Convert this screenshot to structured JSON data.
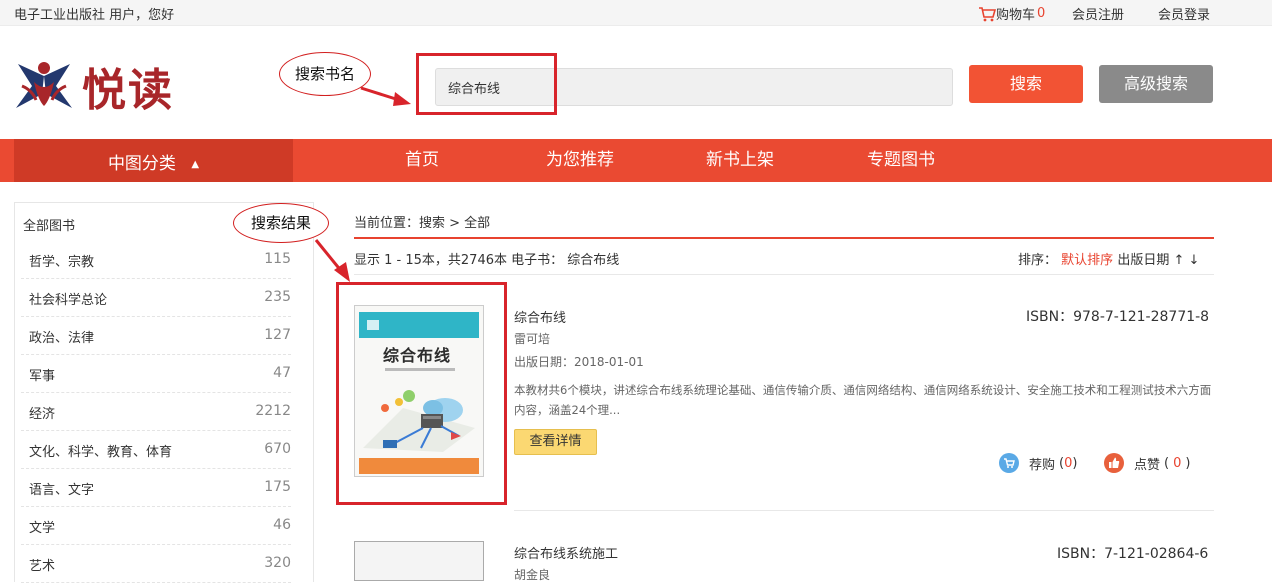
{
  "topbar": {
    "greeting": "电子工业出版社 用户，您好",
    "cart_label": "购物车",
    "cart_count": "0",
    "register": "会员注册",
    "login": "会员登录"
  },
  "header": {
    "logo_text": "悦读",
    "search_value": "综合布线",
    "search_button": "搜索",
    "advanced_button": "高级搜索"
  },
  "annotations": {
    "search_label": "搜索书名",
    "result_label": "搜索结果"
  },
  "nav": {
    "category_label": "中图分类",
    "items": [
      "首页",
      "为您推荐",
      "新书上架",
      "专题图书"
    ]
  },
  "sidebar": {
    "heading": "全部图书",
    "categories": [
      {
        "name": "哲学、宗教",
        "count": "115"
      },
      {
        "name": "社会科学总论",
        "count": "235"
      },
      {
        "name": "政治、法律",
        "count": "127"
      },
      {
        "name": "军事",
        "count": "47"
      },
      {
        "name": "经济",
        "count": "2212"
      },
      {
        "name": "文化、科学、教育、体育",
        "count": "670"
      },
      {
        "name": "语言、文字",
        "count": "175"
      },
      {
        "name": "文学",
        "count": "46"
      },
      {
        "name": "艺术",
        "count": "320"
      }
    ]
  },
  "main": {
    "breadcrumb": "当前位置：搜索 > 全部",
    "result_info": "显示 1 - 15本，共2746本 电子书：  综合布线",
    "sort_label": "排序：",
    "sort_default": "默认排序",
    "sort_date": "出版日期 ↑ ↓",
    "books": [
      {
        "title": "综合布线",
        "author": "雷可培",
        "date": "出版日期：2018-01-01",
        "isbn": "ISBN：978-7-121-28771-8",
        "desc": "本教材共6个模块，讲述综合布线系统理论基础、通信传输介质、通信网络结构、通信网络系统设计、安全施工技术和工程测试技术六方面内容，涵盖24个理...",
        "detail_button": "查看详情",
        "recommend_label": "荐购",
        "recommend_count": "0",
        "like_label": "点赞",
        "like_count": "0",
        "cover_title": "综合布线"
      },
      {
        "title": "综合布线系统施工",
        "author": "胡金良",
        "isbn": "ISBN：7-121-02864-6"
      }
    ]
  },
  "colors": {
    "accent": "#ea4a32",
    "logo": "#a8262a",
    "annotation": "#d8242b"
  }
}
